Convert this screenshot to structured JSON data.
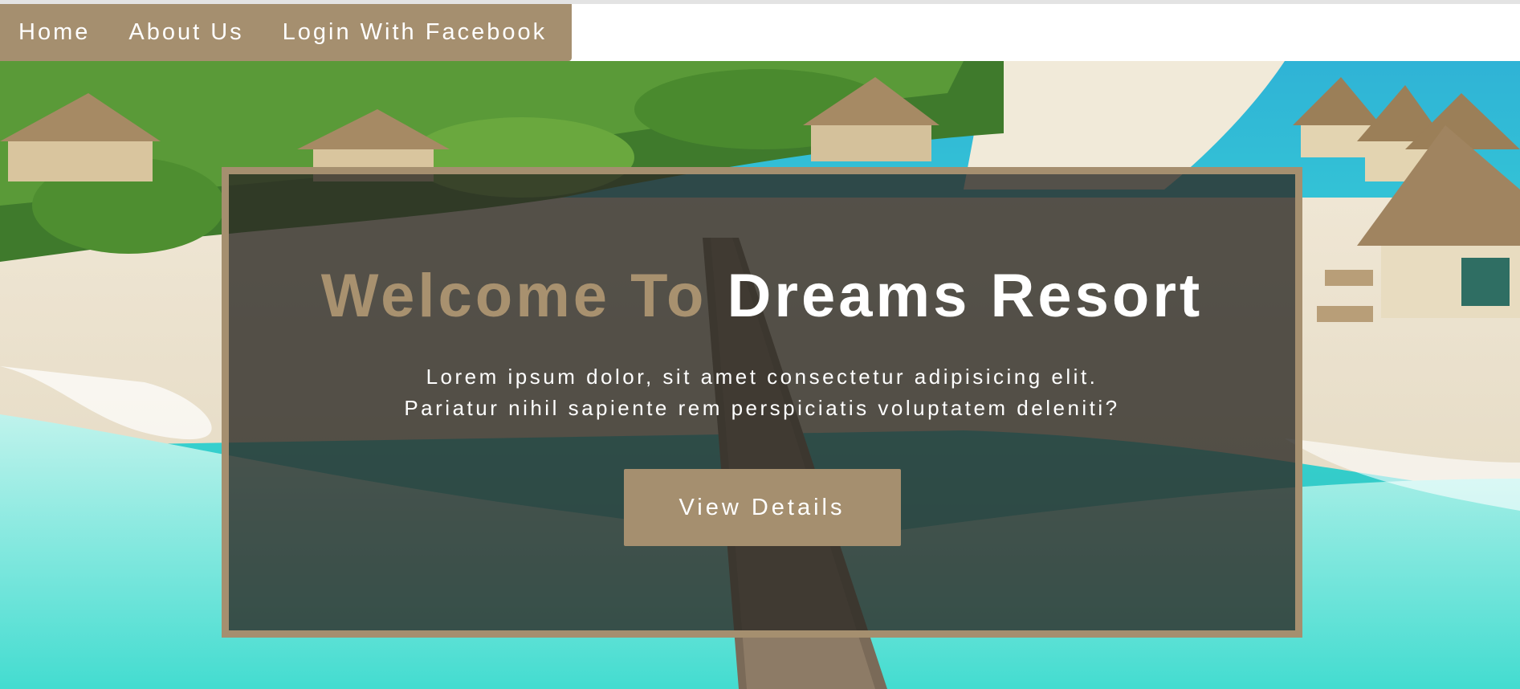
{
  "nav": {
    "items": [
      "Home",
      "About Us",
      "Login With Facebook"
    ]
  },
  "hero": {
    "headline_part1": "Welcome To",
    "headline_part2": "Dreams Resort",
    "lead_text": "Lorem ipsum dolor, sit amet consectetur adipisicing elit. Pariatur nihil sapiente rem perspiciatis voluptatem deleniti?",
    "cta_label": "View Details"
  },
  "colors": {
    "accent": "#a58f6f",
    "overlay": "#2d2b26",
    "text_light": "#ffffff"
  }
}
